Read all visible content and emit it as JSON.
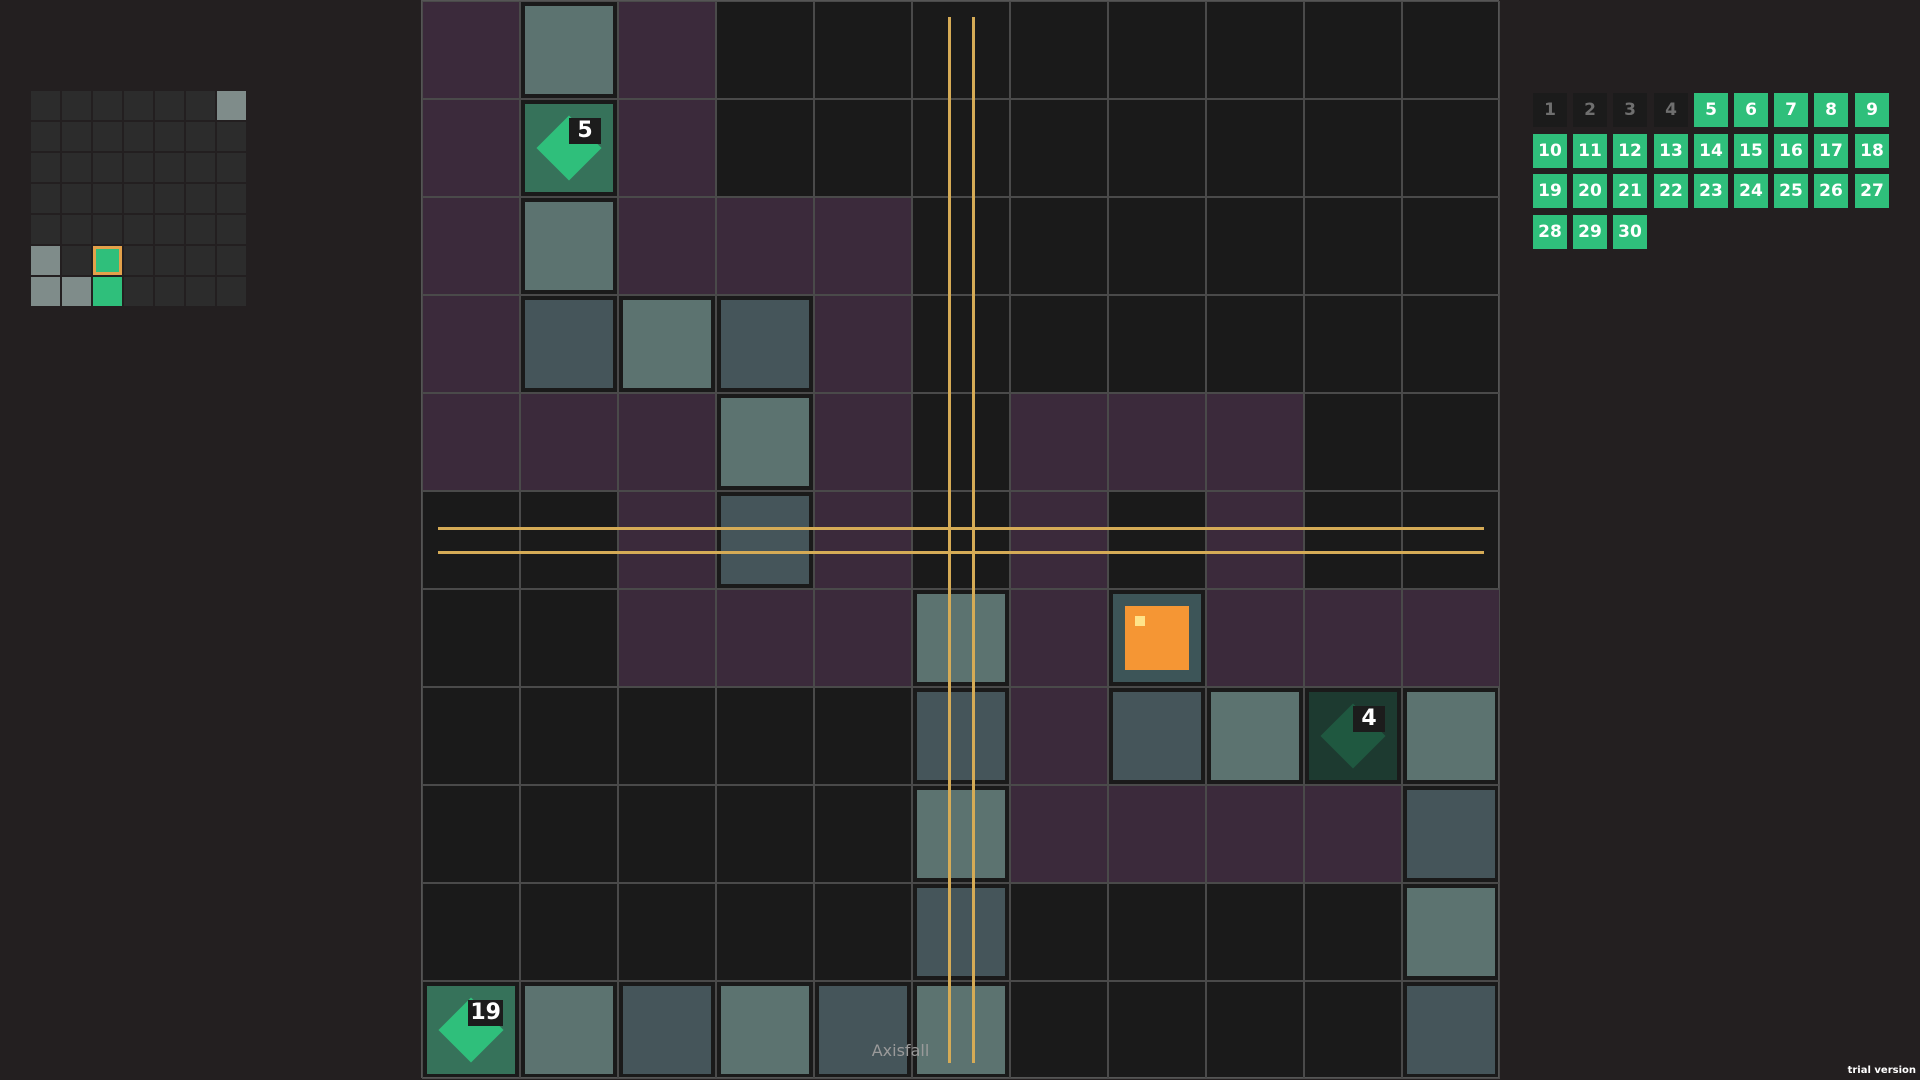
{
  "game_title": "Axisfall",
  "version_label": "trial version",
  "colors": {
    "background": "#231f20",
    "board": "#1a1a1a",
    "purple_tile": "#3b2a3b",
    "gray_tile": "#5c7370",
    "slate_tile": "#45555a",
    "green": "#2fbf7b",
    "orange": "#f59634",
    "axis_line": "#d5ab56"
  },
  "board": {
    "size": 11,
    "rows": [
      "PGP........",
      "PEP........",
      "PGPPP......",
      "PSGSP......",
      "PPPGP.PPP..",
      "..PSP.P.P..",
      "..PPPGPOPPP",
      ".....SPSGDG",
      ".....GPPPPS",
      ".....S....G",
      "FGSGSG....S"
    ],
    "legend": {
      ".": "empty",
      "P": "purple",
      "G": "gray",
      "S": "slate",
      "E": "green-5",
      "D": "green-4-dim",
      "F": "green-19",
      "O": "orange-player"
    },
    "green_pieces": [
      {
        "row": 1,
        "col": 1,
        "number": "5",
        "dim": false
      },
      {
        "row": 7,
        "col": 9,
        "number": "4",
        "dim": true
      },
      {
        "row": 10,
        "col": 0,
        "number": "19",
        "dim": false
      }
    ],
    "player": {
      "row": 6,
      "col": 7
    },
    "axis_vertical_cols": [
      5
    ],
    "axis_horizontal_rows": [
      5
    ]
  },
  "minimap": {
    "size": 7,
    "rows": [
      "......g",
      ".......",
      ".......",
      ".......",
      ".......",
      "g.c....",
      "ggG...."
    ]
  },
  "levels": {
    "items": [
      "1",
      "2",
      "3",
      "4",
      "5",
      "6",
      "7",
      "8",
      "9",
      "10",
      "11",
      "12",
      "13",
      "14",
      "15",
      "16",
      "17",
      "18",
      "19",
      "20",
      "21",
      "22",
      "23",
      "24",
      "25",
      "26",
      "27",
      "28",
      "29",
      "30"
    ],
    "unlocked_from": 5,
    "per_row": 9
  }
}
